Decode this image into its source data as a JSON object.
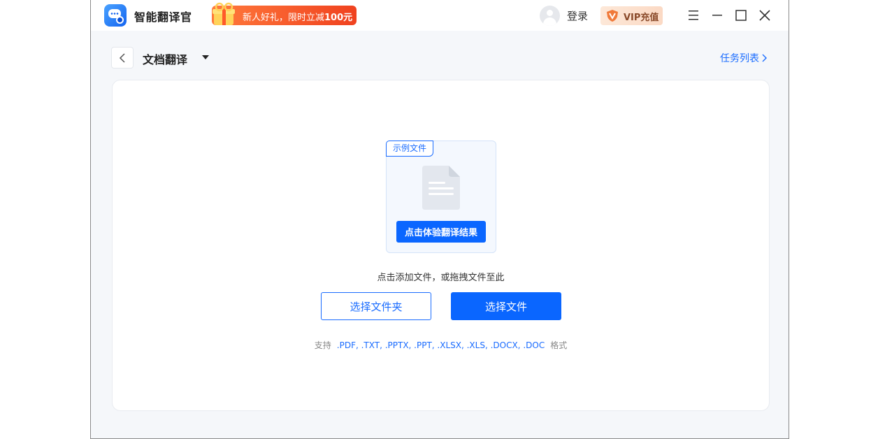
{
  "titlebar": {
    "app_name": "智能翻译官",
    "promo_prefix": "新人好礼，限时立减",
    "promo_amount": "100元",
    "login_label": "登录",
    "vip_label": "VIP充值"
  },
  "subheader": {
    "title": "文档翻译",
    "task_list_label": "任务列表"
  },
  "main": {
    "sample_tag": "示例文件",
    "sample_button": "点击体验翻译结果",
    "drop_hint": "点击添加文件，或拖拽文件至此",
    "select_folder_label": "选择文件夹",
    "select_file_label": "选择文件",
    "formats_prefix": "支持",
    "formats_list": ".PDF, .TXT, .PPTX, .PPT, .XLSX, .XLS, .DOCX, .DOC",
    "formats_suffix": "格式"
  },
  "colors": {
    "accent": "#0a66ff",
    "promo": "#f0421f",
    "vip_text": "#8a4a2a"
  },
  "icons": {
    "app": "translator-robot-icon",
    "promo": "gift-icon",
    "avatar": "user-avatar-icon",
    "vip": "vip-shield-icon",
    "menu": "hamburger-menu-icon",
    "minimize": "minimize-icon",
    "maximize": "maximize-icon",
    "close": "close-icon",
    "back": "chevron-left-icon",
    "dropdown": "caret-down-icon",
    "task_arrow": "chevron-right-icon",
    "document": "document-icon"
  }
}
